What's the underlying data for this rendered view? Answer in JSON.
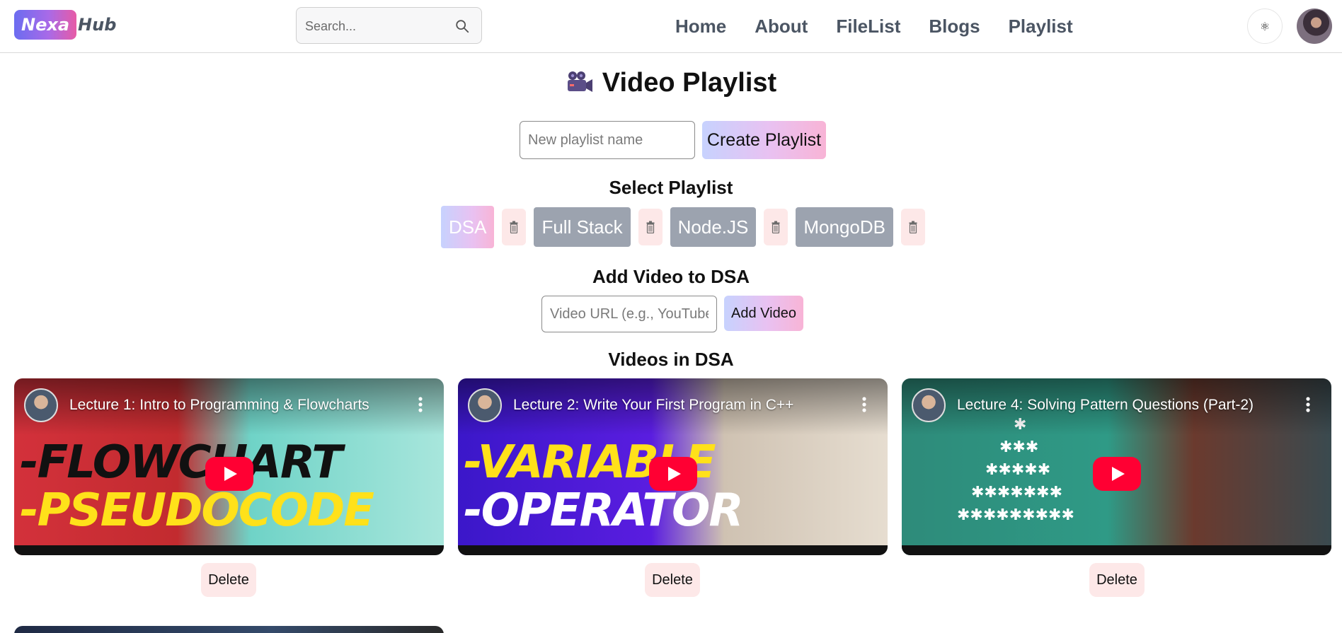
{
  "navbar": {
    "logo_badge": "Nexa",
    "logo_rest": "Hub",
    "search_placeholder": "Search...",
    "links": [
      "Home",
      "About",
      "FileList",
      "Blogs",
      "Playlist"
    ],
    "theme_toggle_glyph": "⚛"
  },
  "page": {
    "title": "Video Playlist",
    "new_playlist_placeholder": "New playlist name",
    "create_button": "Create Playlist",
    "select_heading": "Select Playlist",
    "playlists": [
      "DSA",
      "Full Stack",
      "Node.JS",
      "MongoDB"
    ],
    "active_playlist": "DSA",
    "add_video_heading": "Add Video to DSA",
    "video_url_placeholder": "Video URL (e.g., YouTube",
    "add_video_button": "Add Video",
    "videos_heading": "Videos in DSA"
  },
  "videos": [
    {
      "title": "Lecture 1: Intro to Programming & Flowcharts",
      "overlay_line1": "-FLOWCHART",
      "overlay_line2": "-PSEUDOCODE",
      "delete_label": "Delete"
    },
    {
      "title": "Lecture 2: Write Your First Program in C++",
      "overlay_line1": "-VARIABLE",
      "overlay_line2": "-OPERATOR",
      "delete_label": "Delete"
    },
    {
      "title": "Lecture 4: Solving Pattern Questions (Part-2)",
      "overlay_line1": "",
      "overlay_line2": "",
      "delete_label": "Delete"
    }
  ],
  "colors": {
    "accent_gradient_start": "#c7d2fe",
    "accent_gradient_end": "#f8b4d6",
    "inactive_playlist": "#9ca3af",
    "delete_bg": "#fde8e8",
    "nav_text": "#4b5563",
    "youtube_red": "#ff0033"
  }
}
